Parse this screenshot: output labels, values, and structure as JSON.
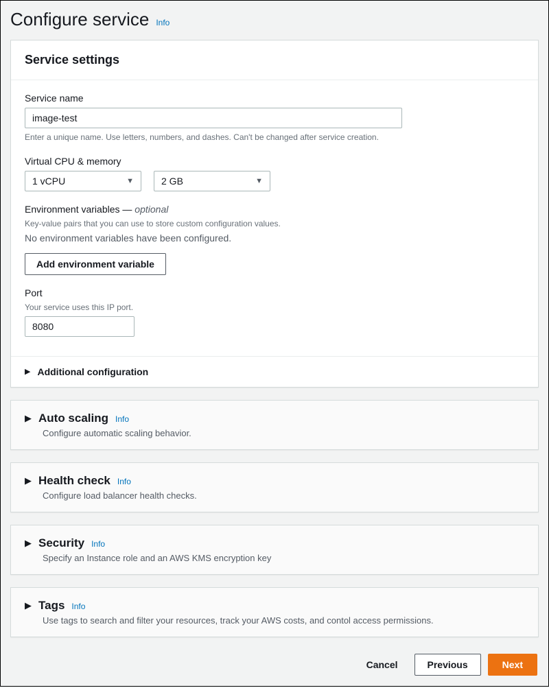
{
  "page": {
    "title": "Configure service",
    "info_label": "Info"
  },
  "service_settings": {
    "heading": "Service settings",
    "service_name": {
      "label": "Service name",
      "value": "image-test",
      "hint": "Enter a unique name. Use letters, numbers, and dashes. Can't be changed after service creation."
    },
    "cpu_memory": {
      "label": "Virtual CPU & memory",
      "vcpu_selected": "1 vCPU",
      "memory_selected": "2 GB"
    },
    "env_vars": {
      "label_text": "Environment variables —",
      "optional_text": " optional",
      "hint": "Key-value pairs that you can use to store custom configuration values.",
      "empty": "No environment variables have been configured.",
      "add_button": "Add environment variable"
    },
    "port": {
      "label": "Port",
      "hint": "Your service uses this IP port.",
      "value": "8080"
    },
    "additional_config": {
      "label": "Additional configuration"
    }
  },
  "sections": [
    {
      "title": "Auto scaling",
      "info": "Info",
      "desc": "Configure automatic scaling behavior."
    },
    {
      "title": "Health check",
      "info": "Info",
      "desc": "Configure load balancer health checks."
    },
    {
      "title": "Security",
      "info": "Info",
      "desc": "Specify an Instance role and an AWS KMS encryption key"
    },
    {
      "title": "Tags",
      "info": "Info",
      "desc": "Use tags to search and filter your resources, track your AWS costs, and contol access permissions."
    }
  ],
  "footer": {
    "cancel": "Cancel",
    "previous": "Previous",
    "next": "Next"
  }
}
